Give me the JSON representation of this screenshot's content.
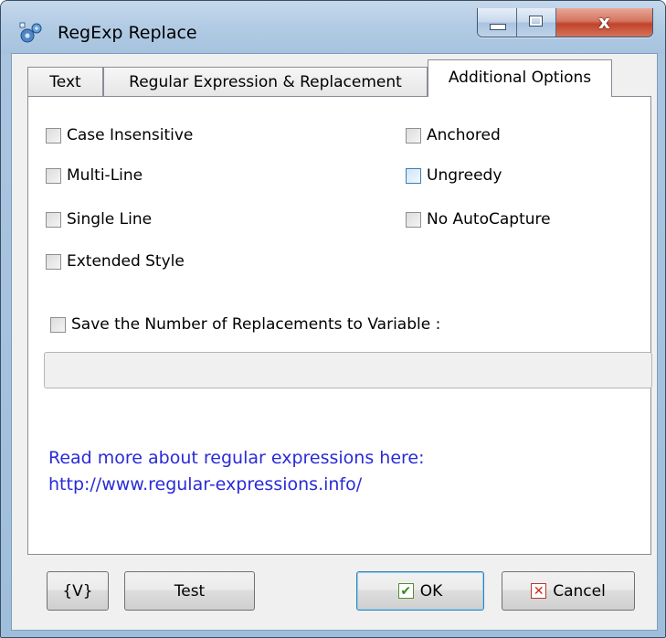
{
  "window": {
    "title": "RegExp Replace",
    "close_glyph": "x",
    "icons": {
      "app": "app-gear-icon",
      "minimize": "minimize-icon",
      "maximize": "maximize-icon",
      "close": "close-icon"
    }
  },
  "tabs": [
    {
      "label": "Text",
      "selected": false
    },
    {
      "label": "Regular Expression & Replacement",
      "selected": false
    },
    {
      "label": "Additional Options",
      "selected": true
    }
  ],
  "options": {
    "case_insensitive": {
      "label": "Case Insensitive",
      "checked": false
    },
    "multi_line": {
      "label": "Multi-Line",
      "checked": false
    },
    "single_line": {
      "label": "Single Line",
      "checked": false
    },
    "extended_style": {
      "label": "Extended Style",
      "checked": false
    },
    "anchored": {
      "label": "Anchored",
      "checked": false
    },
    "ungreedy": {
      "label": "Ungreedy",
      "checked": false,
      "focused": true
    },
    "no_autocapture": {
      "label": "No AutoCapture",
      "checked": false
    }
  },
  "save_count": {
    "label": "Save the Number of Replacements to Variable :",
    "checked": false,
    "value": "",
    "enabled": false
  },
  "info": {
    "line1": "Read more about regular expressions here:",
    "line2": "http://www.regular-expressions.info/",
    "color": "#2a2ad8"
  },
  "buttons": {
    "variable": "{V}",
    "test": "Test",
    "ok": "OK",
    "ok_glyph": "✔",
    "cancel": "Cancel",
    "cancel_glyph": "✕"
  }
}
